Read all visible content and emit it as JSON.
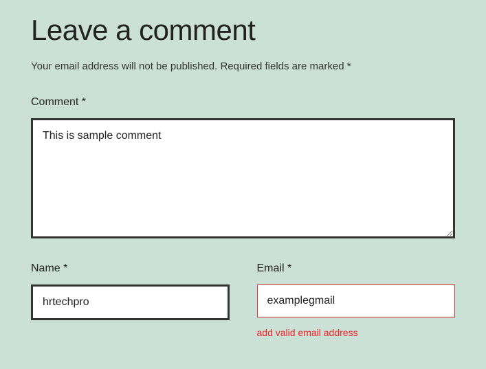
{
  "heading": "Leave a comment",
  "notice": "Your email address will not be published. Required fields are marked *",
  "comment": {
    "label": "Comment *",
    "value": "This is sample comment"
  },
  "name": {
    "label": "Name *",
    "value": "hrtechpro"
  },
  "email": {
    "label": "Email *",
    "value": "examplegmail",
    "error": "add valid email address"
  }
}
